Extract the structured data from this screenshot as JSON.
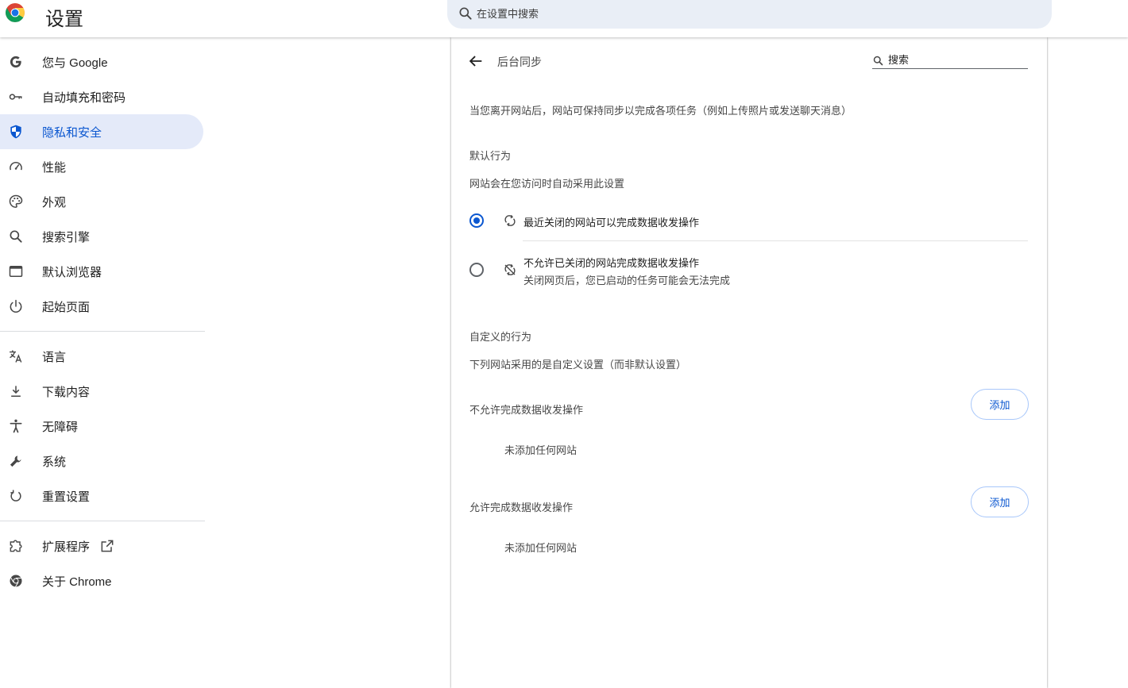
{
  "header": {
    "title": "设置",
    "search_placeholder": "在设置中搜索"
  },
  "sidebar": {
    "items": [
      {
        "label": "您与 Google",
        "icon": "google-g-icon"
      },
      {
        "label": "自动填充和密码",
        "icon": "key-icon"
      },
      {
        "label": "隐私和安全",
        "icon": "shield-icon",
        "active": true
      },
      {
        "label": "性能",
        "icon": "speedometer-icon"
      },
      {
        "label": "外观",
        "icon": "palette-icon"
      },
      {
        "label": "搜索引擎",
        "icon": "search-icon"
      },
      {
        "label": "默认浏览器",
        "icon": "browser-window-icon"
      },
      {
        "label": "起始页面",
        "icon": "power-icon"
      },
      {
        "label": "语言",
        "icon": "translate-icon"
      },
      {
        "label": "下载内容",
        "icon": "download-icon"
      },
      {
        "label": "无障碍",
        "icon": "accessibility-icon"
      },
      {
        "label": "系统",
        "icon": "wrench-icon"
      },
      {
        "label": "重置设置",
        "icon": "reset-icon"
      },
      {
        "label": "扩展程序",
        "icon": "puzzle-icon"
      },
      {
        "label": "关于 Chrome",
        "icon": "chrome-icon"
      }
    ]
  },
  "page": {
    "title": "后台同步",
    "search_placeholder": "搜索",
    "description": "当您离开网站后，网站可保持同步以完成各项任务（例如上传照片或发送聊天消息）",
    "default_behavior": {
      "heading": "默认行为",
      "subheading": "网站会在您访问时自动采用此设置",
      "options": [
        {
          "label": "最近关闭的网站可以完成数据收发操作",
          "selected": true,
          "icon": "sync-icon"
        },
        {
          "label": "不允许已关闭的网站完成数据收发操作",
          "sublabel": "关闭网页后，您已启动的任务可能会无法完成",
          "selected": false,
          "icon": "sync-disabled-icon"
        }
      ]
    },
    "custom_behavior": {
      "heading": "自定义的行为",
      "subheading": "下列网站采用的是自定义设置（而非默认设置）",
      "blocked": {
        "heading": "不允许完成数据收发操作",
        "add_label": "添加",
        "empty_text": "未添加任何网站"
      },
      "allowed": {
        "heading": "允许完成数据收发操作",
        "add_label": "添加",
        "empty_text": "未添加任何网站"
      }
    }
  },
  "colors": {
    "accent": "#0b57d0",
    "active_bg": "#e4eaf9",
    "search_bg": "#e9eef6"
  }
}
